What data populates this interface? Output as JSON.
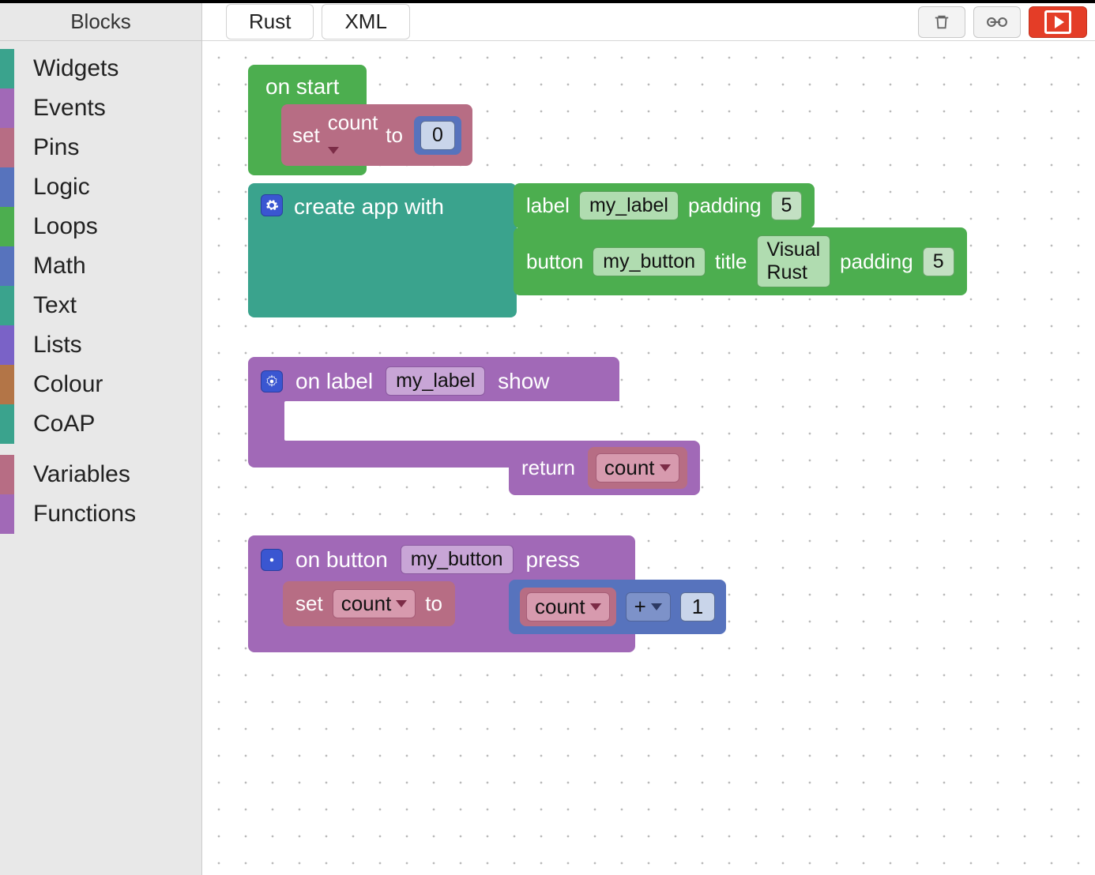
{
  "topbar": {
    "blocks_tab": "Blocks",
    "tabs": [
      "Rust",
      "XML"
    ]
  },
  "sidebar": {
    "categories": [
      {
        "label": "Widgets",
        "color": "#3aa38d"
      },
      {
        "label": "Events",
        "color": "#a169b7"
      },
      {
        "label": "Pins",
        "color": "#b76d84"
      },
      {
        "label": "Logic",
        "color": "#5773bd"
      },
      {
        "label": "Loops",
        "color": "#4cae4f"
      },
      {
        "label": "Math",
        "color": "#5773bd"
      },
      {
        "label": "Text",
        "color": "#3aa38d"
      },
      {
        "label": "Lists",
        "color": "#7a62c7"
      },
      {
        "label": "Colour",
        "color": "#b37547"
      },
      {
        "label": "CoAP",
        "color": "#3aa38d"
      }
    ],
    "extra": [
      {
        "label": "Variables",
        "color": "#b76d84"
      },
      {
        "label": "Functions",
        "color": "#a169b7"
      }
    ]
  },
  "blocks": {
    "on_start": {
      "title": "on start",
      "set_word": "set",
      "var": "count",
      "to_word": "to",
      "value": "0"
    },
    "create_app": {
      "title": "create app with",
      "label_row": {
        "kw_label": "label",
        "name": "my_label",
        "kw_padding": "padding",
        "padding": "5"
      },
      "button_row": {
        "kw_button": "button",
        "name": "my_button",
        "kw_title": "title",
        "title": "Visual Rust",
        "kw_padding": "padding",
        "padding": "5"
      }
    },
    "on_label": {
      "kw_on": "on label",
      "name": "my_label",
      "kw_show": "show",
      "kw_return": "return",
      "var": "count"
    },
    "on_button": {
      "kw_on": "on button",
      "name": "my_button",
      "kw_press": "press",
      "set_word": "set",
      "var": "count",
      "to_word": "to",
      "expr_var": "count",
      "op": "+",
      "operand": "1"
    }
  }
}
